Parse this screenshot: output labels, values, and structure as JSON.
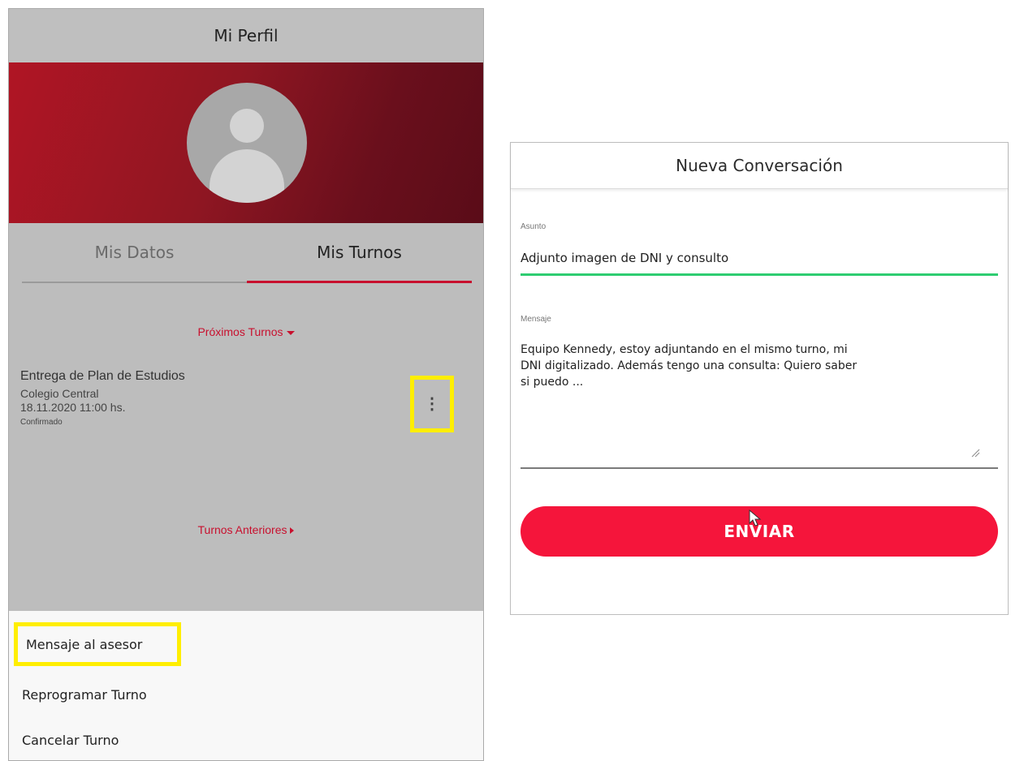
{
  "profile": {
    "header_title": "Mi Perfil",
    "tabs": [
      {
        "label": "Mis Datos",
        "active": false
      },
      {
        "label": "Mis Turnos",
        "active": true
      }
    ],
    "proximos_label": "Próximos Turnos",
    "appointment": {
      "title": "Entrega de Plan de Estudios",
      "location": "Colegio Central",
      "datetime": "18.11.2020 11:00 hs.",
      "status": "Confirmado"
    },
    "more_menu_icon": "⋮",
    "anteriores_label": "Turnos Anteriores",
    "sheet_items": [
      {
        "label": "Mensaje al asesor"
      },
      {
        "label": "Reprogramar Turno"
      },
      {
        "label": "Cancelar Turno"
      }
    ]
  },
  "dialog": {
    "title": "Nueva Conversación",
    "asunto_label": "Asunto",
    "asunto_value": "Adjunto imagen de DNI y consulto",
    "mensaje_label": "Mensaje",
    "mensaje_value": "Equipo Kennedy, estoy adjuntando en el mismo turno, mi\nDNI digitalizado. Además tengo una consulta: Quiero saber\nsi puedo ...",
    "send_label": "ENVIAR"
  },
  "colors": {
    "accent": "#c8102e",
    "send_button": "#f5153b",
    "highlight": "#ffee00",
    "focus_line": "#2ecc71"
  }
}
